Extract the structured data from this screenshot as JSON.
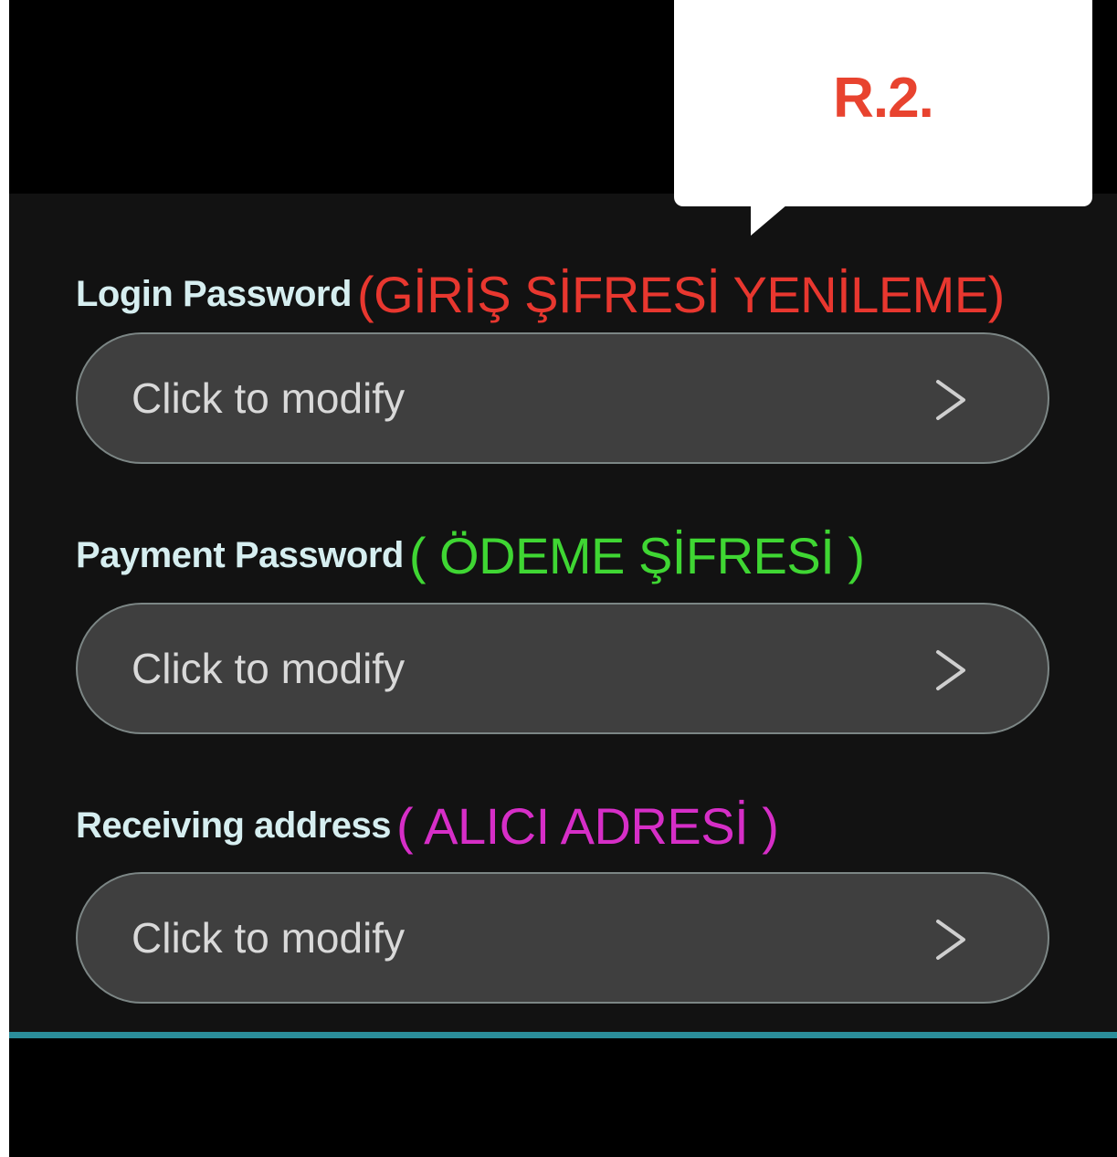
{
  "callout": {
    "text": "R.2."
  },
  "settings": [
    {
      "label": "Login Password",
      "note": "(GİRİŞ ŞİFRESİ YENİLEME)",
      "note_color": "#e8372f",
      "value": "Click to modify",
      "icon": "chevron-right-icon"
    },
    {
      "label": "Payment Password",
      "note": "( ÖDEME ŞİFRESİ )",
      "note_color": "#3fd633",
      "value": "Click to modify",
      "icon": "chevron-right-icon"
    },
    {
      "label": "Receiving address",
      "note": "( ALICI ADRESİ )",
      "note_color": "#d62ec7",
      "value": "Click to modify",
      "icon": "chevron-right-icon"
    }
  ],
  "colors": {
    "background": "#121212",
    "accent_line": "#2b8e9b",
    "label": "#d6eef0",
    "callout_text": "#e8432f"
  }
}
